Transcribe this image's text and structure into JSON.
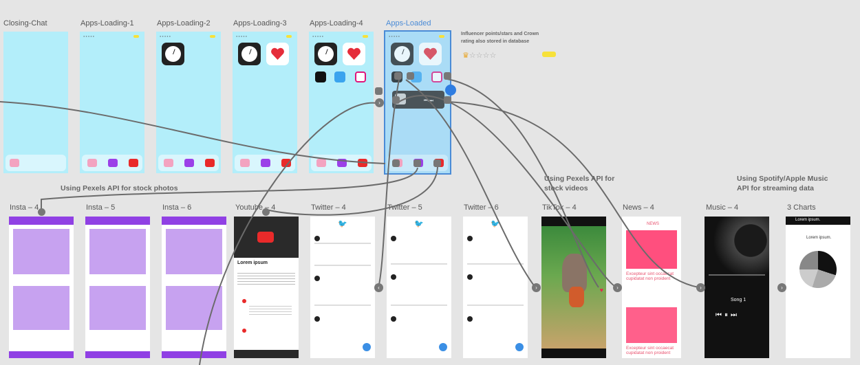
{
  "frames_top": [
    {
      "name": "Closing-Chat"
    },
    {
      "name": "Apps-Loading-1"
    },
    {
      "name": "Apps-Loading-2"
    },
    {
      "name": "Apps-Loading-3"
    },
    {
      "name": "Apps-Loading-4"
    },
    {
      "name": "Apps-Loaded"
    }
  ],
  "frames_bottom": [
    {
      "name": "Insta – 4"
    },
    {
      "name": "Insta – 5"
    },
    {
      "name": "Insta – 6"
    },
    {
      "name": "Youtube – 4"
    },
    {
      "name": "Twitter – 4"
    },
    {
      "name": "Twitter – 5"
    },
    {
      "name": "Twitter – 6"
    },
    {
      "name": "TikTok – 4"
    },
    {
      "name": "News – 4"
    },
    {
      "name": "Music – 4"
    },
    {
      "name": "3 Charts"
    }
  ],
  "notes": {
    "influencer": "Influencer points/stars and Crown rating also stored in database",
    "pexels_photos": "Using Pexels API for stock photos",
    "pexels_videos": "Using Pexels API for stock videos",
    "spotify": "Using Spotify/Apple Music API for streaming data"
  },
  "small_text": {
    "lorem_ipsum": "Lorem ipsum",
    "lorem_head": "Lorem ipsum",
    "song": "Song 1",
    "news_header": "NEWS",
    "news_headline_1": "Excepteur sint occaecat cupidatat non proident",
    "news_headline_2": "Excepteur sint occaecat cupidatat non proident",
    "charts_title": "Lorem ipsum.",
    "charts_header": "Lorem ipsum."
  },
  "colors": {
    "accent": "#4a8bd6",
    "cyan": "#b3eefa",
    "insta": "#9040e4",
    "youtube": "#e92a2a",
    "news": "#ff4f7e"
  }
}
